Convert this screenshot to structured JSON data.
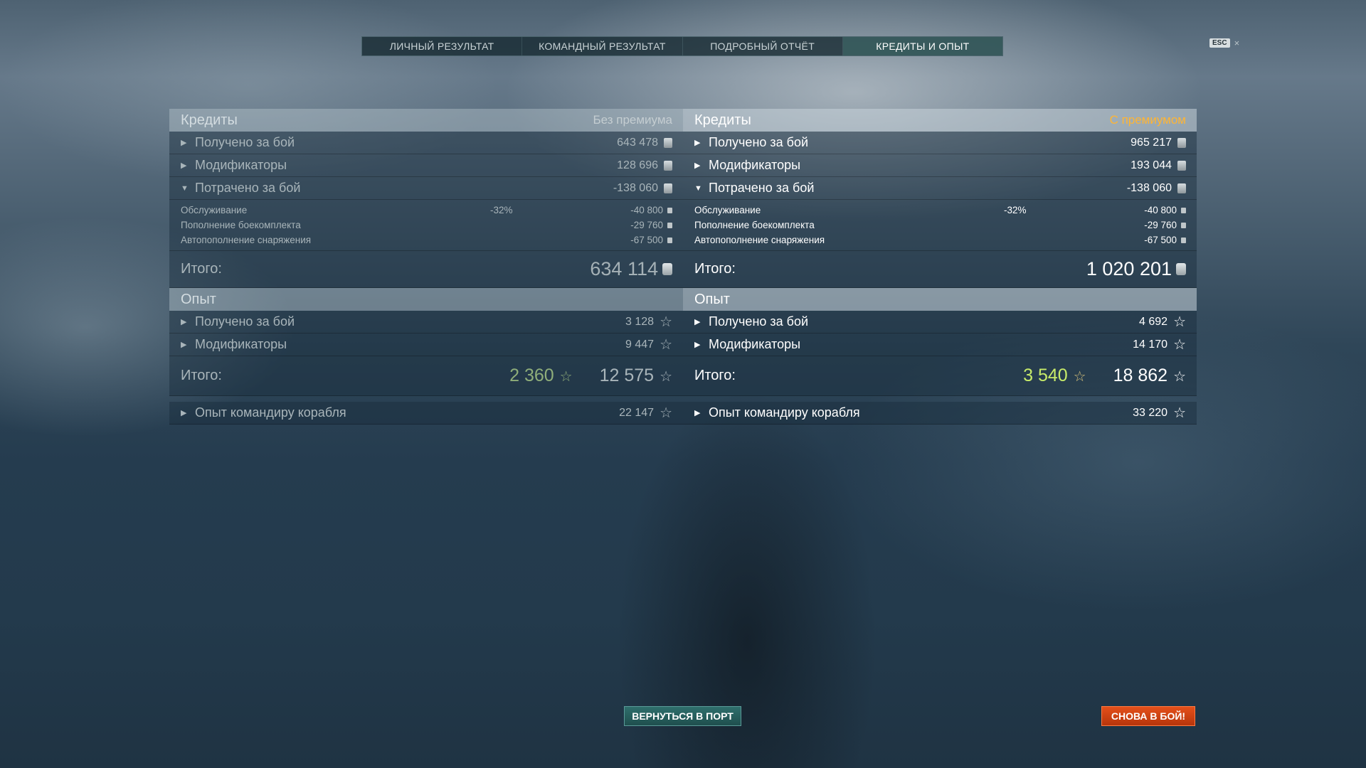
{
  "tabs": [
    {
      "label": "ЛИЧНЫЙ РЕЗУЛЬТАТ",
      "active": false
    },
    {
      "label": "КОМАНДНЫЙ РЕЗУЛЬТАТ",
      "active": false
    },
    {
      "label": "ПОДРОБНЫЙ ОТЧЁТ",
      "active": false
    },
    {
      "label": "КРЕДИТЫ И ОПЫТ",
      "active": true
    }
  ],
  "esc": {
    "key": "ESC",
    "close": "×"
  },
  "left": {
    "credits_header": "Кредиты",
    "mode_label": "Без премиума",
    "earned_label": "Получено за бой",
    "earned_value": "643 478",
    "modifiers_label": "Модификаторы",
    "modifiers_value": "128 696",
    "spent_label": "Потрачено за бой",
    "spent_value": "-138 060",
    "service_label": "Обслуживание",
    "service_pct": "-32%",
    "service_value": "-40 800",
    "ammo_label": "Пополнение боекомплекта",
    "ammo_value": "-29 760",
    "auto_label": "Автопополнение снаряжения",
    "auto_value": "-67 500",
    "total_label": "Итого:",
    "total_value": "634 114",
    "xp_header": "Опыт",
    "xp_earned_label": "Получено за бой",
    "xp_earned_value": "3 128",
    "xp_mod_label": "Модификаторы",
    "xp_mod_value": "9 447",
    "xp_total_label": "Итого:",
    "xp_total_free": "2 360",
    "xp_total_value": "12 575",
    "commander_label": "Опыт командиру корабля",
    "commander_value": "22 147"
  },
  "right": {
    "credits_header": "Кредиты",
    "mode_label": "С премиумом",
    "earned_label": "Получено за бой",
    "earned_value": "965 217",
    "modifiers_label": "Модификаторы",
    "modifiers_value": "193 044",
    "spent_label": "Потрачено за бой",
    "spent_value": "-138 060",
    "service_label": "Обслуживание",
    "service_pct": "-32%",
    "service_value": "-40 800",
    "ammo_label": "Пополнение боекомплекта",
    "ammo_value": "-29 760",
    "auto_label": "Автопополнение снаряжения",
    "auto_value": "-67 500",
    "total_label": "Итого:",
    "total_value": "1 020 201",
    "xp_header": "Опыт",
    "xp_earned_label": "Получено за бой",
    "xp_earned_value": "4 692",
    "xp_mod_label": "Модификаторы",
    "xp_mod_value": "14 170",
    "xp_total_label": "Итого:",
    "xp_total_free": "3 540",
    "xp_total_value": "18 862",
    "commander_label": "Опыт командиру корабля",
    "commander_value": "33 220"
  },
  "buttons": {
    "return_port": "ВЕРНУТЬСЯ В ПОРТ",
    "battle_again": "СНОВА В БОЙ!"
  },
  "colors": {
    "premium_accent": "#ffb534",
    "free_xp_green": "#c8ec6a",
    "battle_button": "#e4501a",
    "port_button": "#2f6f6c"
  },
  "icons": {
    "credits": "credits-coin-icon",
    "xp": "star-icon",
    "expand": "triangle-right-icon",
    "collapse": "triangle-down-icon"
  }
}
